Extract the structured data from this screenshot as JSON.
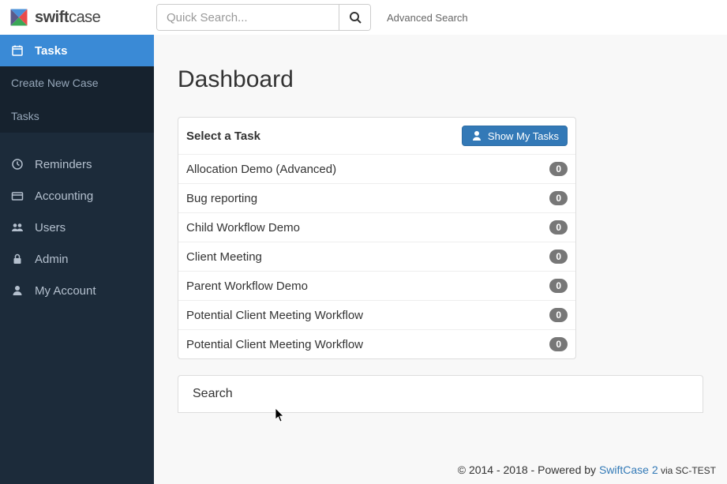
{
  "brand": {
    "name_bold": "swift",
    "name_light": "case"
  },
  "search": {
    "placeholder": "Quick Search...",
    "advanced": "Advanced Search"
  },
  "sidebar": {
    "items": [
      {
        "label": "Tasks"
      },
      {
        "label": "Reminders"
      },
      {
        "label": "Accounting"
      },
      {
        "label": "Users"
      },
      {
        "label": "Admin"
      },
      {
        "label": "My Account"
      }
    ],
    "subs": [
      {
        "label": "Create New Case"
      },
      {
        "label": "Tasks"
      }
    ]
  },
  "page": {
    "title": "Dashboard"
  },
  "panel": {
    "title": "Select a Task",
    "button": "Show My Tasks",
    "tasks": [
      {
        "label": "Allocation Demo (Advanced)",
        "count": "0"
      },
      {
        "label": "Bug reporting",
        "count": "0"
      },
      {
        "label": "Child Workflow Demo",
        "count": "0"
      },
      {
        "label": "Client Meeting",
        "count": "0"
      },
      {
        "label": "Parent Workflow Demo",
        "count": "0"
      },
      {
        "label": "Potential Client Meeting Workflow",
        "count": "0"
      },
      {
        "label": "Potential Client Meeting Workflow",
        "count": "0"
      }
    ]
  },
  "search_panel": {
    "title": "Search"
  },
  "footer": {
    "copyright": "© 2014 - 2018 - Powered by ",
    "link": "SwiftCase 2",
    "via": " via ",
    "host": "SC-TEST"
  }
}
